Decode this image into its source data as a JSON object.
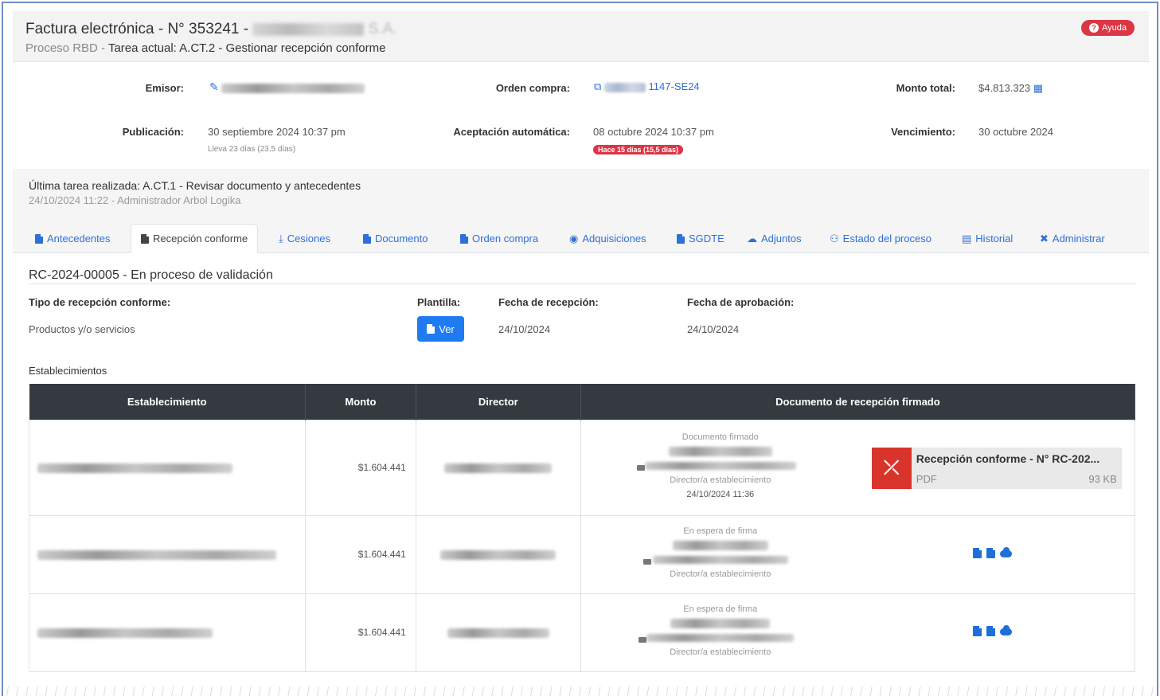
{
  "header": {
    "title": "Factura electrónica - N° 353241 -",
    "title_suffix": "S.A.",
    "process_label": "Proceso RBD",
    "sep": " - ",
    "task": "Tarea actual: A.CT.2 - Gestionar recepción conforme",
    "help_label": "Ayuda"
  },
  "info": {
    "emisor_label": "Emisor:",
    "orden_label": "Orden compra:",
    "orden_value": "1147-SE24",
    "monto_label": "Monto total:",
    "monto_value": "$4.813.323",
    "publicacion_label": "Publicación:",
    "publicacion_value": "30 septiembre 2024 10:37 pm",
    "publicacion_note": "Lleva 23 días (23,5 días)",
    "aceptacion_label": "Aceptación automática:",
    "aceptacion_value": "08 octubre 2024 10:37 pm",
    "aceptacion_badge": "Hace 15 días (15,5 días)",
    "vencimiento_label": "Vencimiento:",
    "vencimiento_value": "30 octubre 2024"
  },
  "last_task": {
    "title": "Última tarea realizada: A.CT.1 - Revisar documento y antecedentes",
    "meta": "24/10/2024 11:22 - Administrador Arbol Logika"
  },
  "tabs": [
    {
      "label": "Antecedentes"
    },
    {
      "label": "Recepción conforme"
    },
    {
      "label": "Cesiones"
    },
    {
      "label": "Documento"
    },
    {
      "label": "Orden compra"
    },
    {
      "label": "Adquisiciones"
    },
    {
      "label": "SGDTE"
    },
    {
      "label": "Adjuntos"
    },
    {
      "label": "Estado del proceso"
    },
    {
      "label": "Historial"
    },
    {
      "label": "Administrar"
    }
  ],
  "rc": {
    "title": "RC-2024-00005 - En proceso de validación",
    "tipo_label": "Tipo de recepción conforme:",
    "tipo_value": "Productos y/o servicios",
    "plantilla_label": "Plantilla:",
    "ver_label": "Ver",
    "fecha_recepcion_label": "Fecha de recepción:",
    "fecha_recepcion_value": "24/10/2024",
    "fecha_aprobacion_label": "Fecha de aprobación:",
    "fecha_aprobacion_value": "24/10/2024"
  },
  "establecimientos": {
    "title": "Establecimientos",
    "columns": [
      "Establecimiento",
      "Monto",
      "Director",
      "Documento de recepción firmado"
    ],
    "rows": [
      {
        "monto": "$1.604.441",
        "doc_status": "Documento firmado",
        "role": "Director/a establecimiento",
        "date": "24/10/2024 11:36",
        "pdf_name": "Recepción conforme - N° RC-202...",
        "pdf_type": "PDF",
        "pdf_size": "93 KB"
      },
      {
        "monto": "$1.604.441",
        "doc_status": "En espera de firma",
        "role": "Director/a establecimiento"
      },
      {
        "monto": "$1.604.441",
        "doc_status": "En espera de firma",
        "role": "Director/a establecimiento"
      }
    ]
  }
}
